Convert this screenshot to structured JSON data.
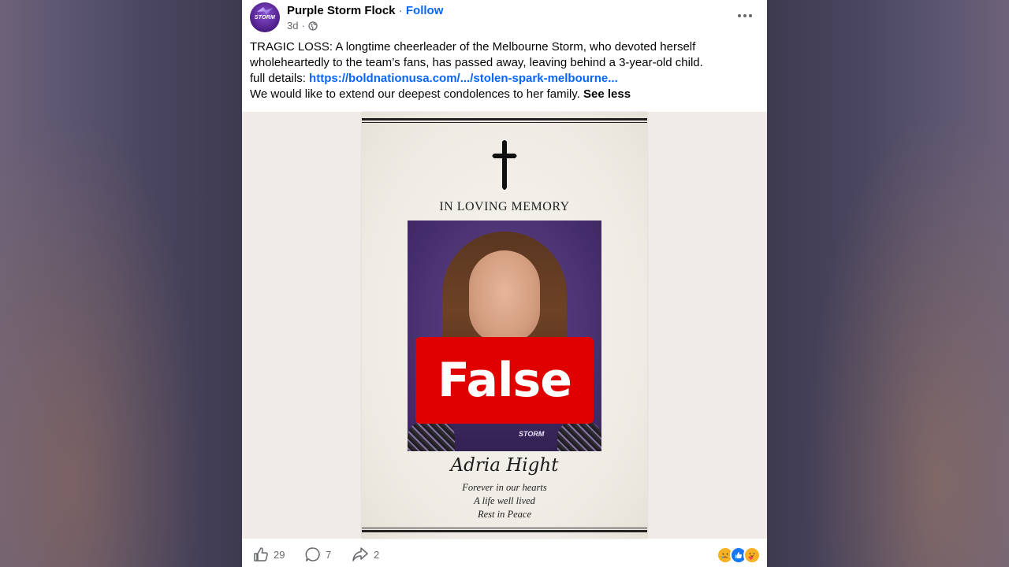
{
  "post": {
    "page_name": "Purple Storm Flock",
    "separator": "·",
    "follow_label": "Follow",
    "avatar_text": "STORM",
    "time_ago": "3d",
    "caption": {
      "line1": "TRAGIC LOSS: A longtime cheerleader of the Melbourne Storm, who devoted herself",
      "line2": "wholeheartedly to the team’s fans, has passed away, leaving behind a 3-year-old child.",
      "details_prefix": "full details: ",
      "link_text": "https://boldnationusa.com/.../stolen-spark-melbourne...",
      "line4": "We would like to extend our deepest condolences to her family. ",
      "see_less": "See less"
    }
  },
  "memorial": {
    "title": "IN LOVING MEMORY",
    "name": "Adria Hight",
    "epitaph": [
      "Forever in our hearts",
      "A life well lived",
      "Rest in Peace"
    ],
    "jersey_text": "STORM",
    "fact_check_label": "False"
  },
  "actions": {
    "like_count": "29",
    "comment_count": "7",
    "share_count": "2"
  },
  "reactions": [
    "sad",
    "like",
    "care"
  ],
  "colors": {
    "link": "#0866ff",
    "false_badge": "#e00000",
    "like_blue": "#1877f2"
  }
}
